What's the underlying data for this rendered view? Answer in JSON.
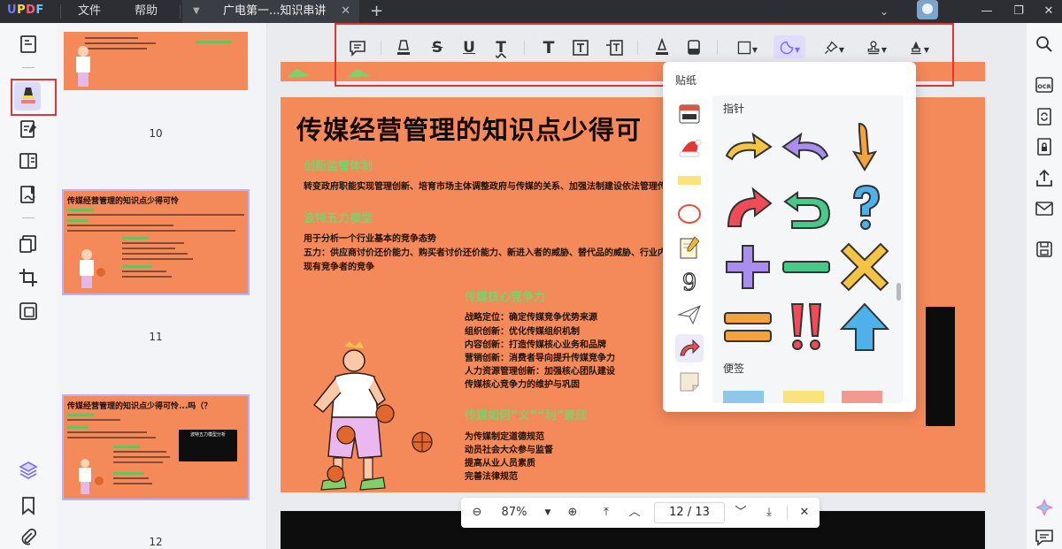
{
  "app": {
    "logo": "UPDF",
    "menu": [
      "文件",
      "帮助"
    ],
    "tab_title": "广电第一...知识串讲"
  },
  "thumbnails": [
    {
      "page_number": "10"
    },
    {
      "page_number": "11",
      "title": "传媒经营管理的知识点少得可怜"
    },
    {
      "page_number": "12",
      "title": "传媒经营管理的知识点少得可怜...吗（？",
      "box_title": "波特五力模型分析"
    }
  ],
  "page": {
    "title": "传媒经营管理的知识点少得可",
    "s1_heading": "创新监管体制",
    "s1_text": "转变政府职能实现管理创新、培育市场主体调整政府与传媒的关系、加强法制建设依法管理传",
    "s2_heading": "波特五力模型",
    "s2_line1": "用于分析一个行业基本的竞争态势",
    "s2_line2": "五力：供应商讨价还价能力、购买者讨价还价能力、新进入者的威胁、替代品的威胁、行业内",
    "s2_line3": "现有竞争者的竞争",
    "s3_heading": "传媒核心竞争力",
    "s3_items": [
      "战略定位：确定传媒竞争优势来源",
      "组织创新：优化传媒组织机制",
      "内容创新：打造传媒核心业务和品牌",
      "营销创新：消费者导向提升传媒竞争力",
      "人力资源管理创新：加强核心团队建设",
      "传媒核心竞争力的维护与巩固"
    ],
    "s4_heading": "传媒如何“义”“利”兼顾",
    "s4_items": [
      "为传媒制定道德规范",
      "动员社会大众参与监督",
      "提高从业人员素质",
      "完善法律规范"
    ]
  },
  "sticker_panel": {
    "title": "贴纸",
    "section_pointer": "指针",
    "section_notes": "便签"
  },
  "zoom": {
    "level": "87%",
    "current_page": "12",
    "separator": "/",
    "total_pages": "13"
  },
  "colors": {
    "accent": "#7b6cff",
    "highlight": "#e53434",
    "page_bg": "#f4895a",
    "heading_green": "#7fcf6a"
  }
}
